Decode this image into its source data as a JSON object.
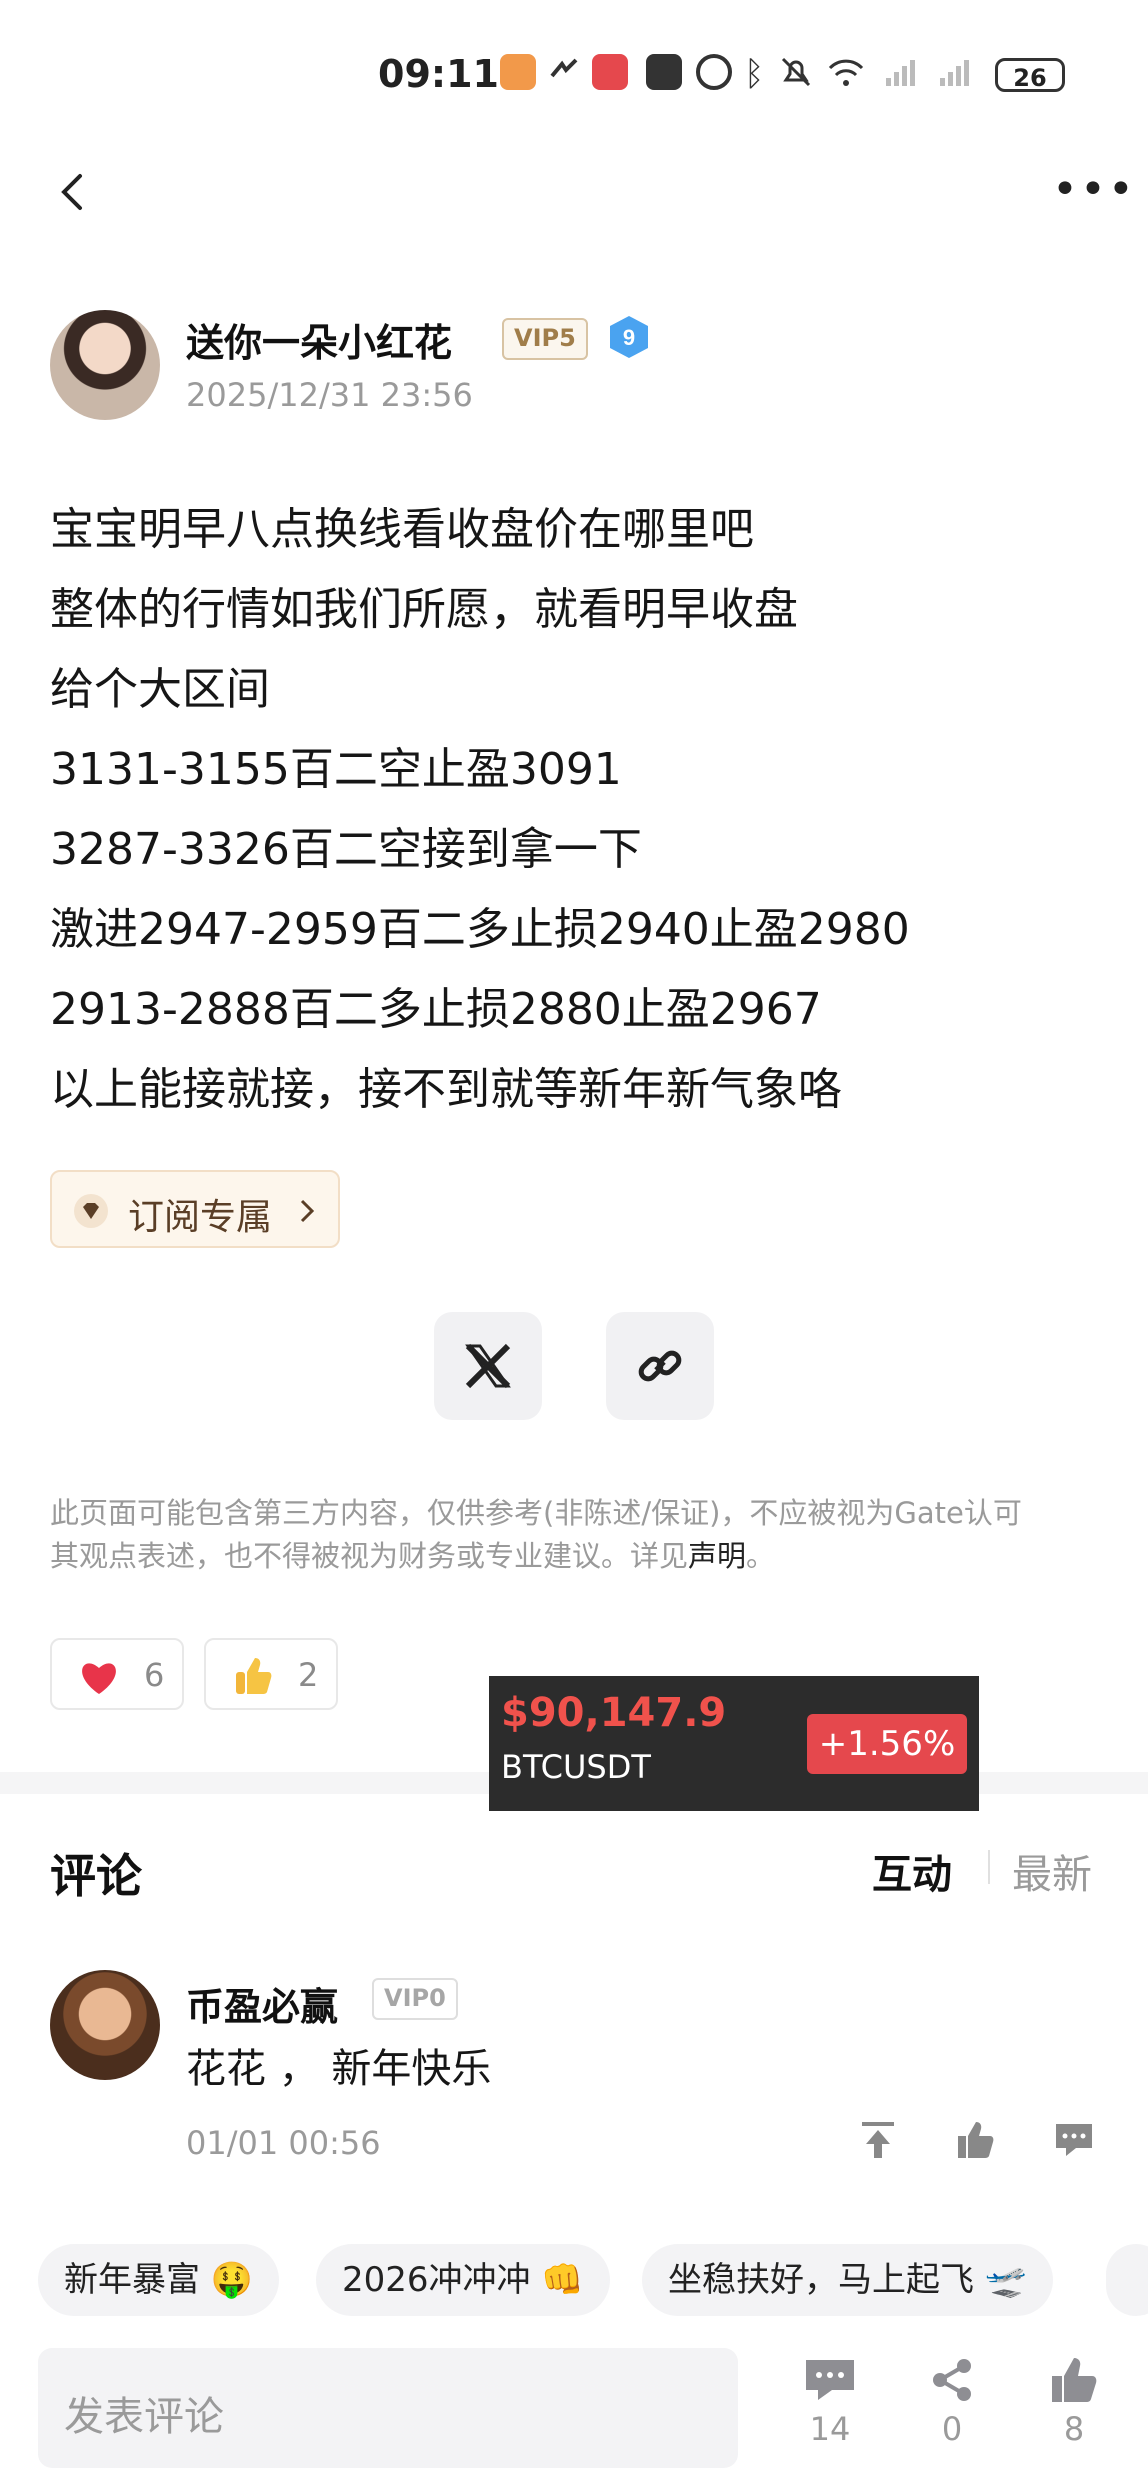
{
  "status_bar": {
    "time": "09:11",
    "battery": "26"
  },
  "author": {
    "name": "送你一朵小红花",
    "vip": "VIP5",
    "level": "9",
    "time": "2025/12/31 23:56"
  },
  "post_lines": [
    "宝宝明早八点换线看收盘价在哪里吧",
    "整体的行情如我们所愿，就看明早收盘",
    "给个大区间",
    "3131-3155百二空止盈3091",
    "3287-3326百二空接到拿一下",
    "激进2947-2959百二多止损2940止盈2980",
    "2913-2888百二多止损2880止盈2967",
    "以上能接就接，接不到就等新年新气象咯"
  ],
  "subscribe_label": "订阅专属",
  "disclaimer": {
    "line1": "此页面可能包含第三方内容，仅供参考(非陈述/保证)，不应被视为Gate认可",
    "line2": "其观点表述，也不得被视为财务或专业建议。详见",
    "link": "声明",
    "end": "。"
  },
  "reactions": {
    "heart": "6",
    "thumb": "2"
  },
  "ticker": {
    "price": "$90,147.9",
    "symbol": "BTCUSDT",
    "change": "+1.56%"
  },
  "comments": {
    "title": "评论",
    "tab_hot": "互动",
    "tab_new": "最新",
    "item": {
      "name": "币盈必赢",
      "vip": "VIP0",
      "text": "花花 ， 新年快乐",
      "time": "01/01 00:56"
    }
  },
  "chips": [
    "新年暴富 🤑",
    "2026冲冲冲 👊",
    "坐稳扶好，马上起飞 🛫"
  ],
  "bottom_bar": {
    "placeholder": "发表评论",
    "comment_count": "14",
    "share_count": "0",
    "like_count": "8"
  },
  "colors": {
    "accent_red": "#e5484d",
    "vip_gold": "#a07d4a",
    "ticker_bg": "#2c2c2c"
  }
}
